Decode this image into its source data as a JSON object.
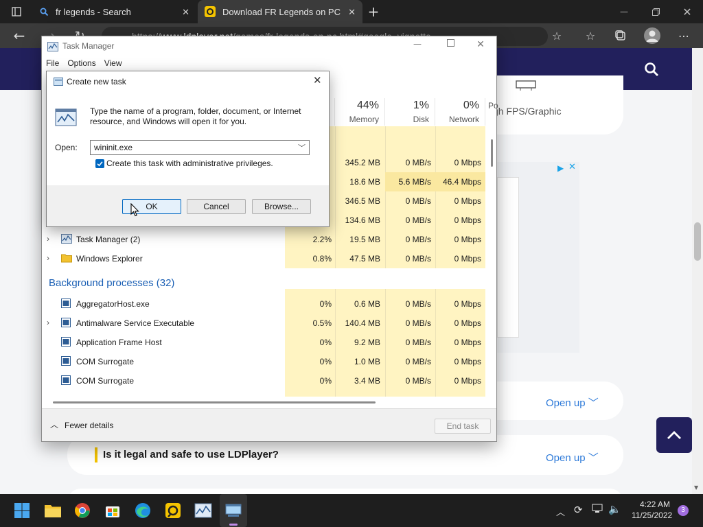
{
  "browser": {
    "tabs": [
      {
        "title": "fr legends - Search",
        "active": false
      },
      {
        "title": "Download FR Legends on PC (Em",
        "active": true
      }
    ],
    "address": {
      "prefix": "https://",
      "domain": "www.ldplayer.net",
      "path": "/games/fr-legends-on-pc.html#google_vignette"
    }
  },
  "webpage": {
    "feature_text": "gh FPS/Graphic",
    "faq": [
      {
        "question": "",
        "open_label": "Open up"
      },
      {
        "question": "Is it legal and safe to use LDPlayer?",
        "open_label": "Open up"
      }
    ],
    "accent": "#22205c",
    "link_color": "#2f7bd9"
  },
  "task_manager": {
    "title": "Task Manager",
    "menu": [
      "File",
      "Options",
      "View"
    ],
    "columns": [
      {
        "pct": "44%",
        "label": "Memory"
      },
      {
        "pct": "1%",
        "label": "Disk"
      },
      {
        "pct": "0%",
        "label": "Network"
      },
      {
        "pct": "",
        "label": "Po"
      }
    ],
    "hidden_rows": [
      {
        "cpu": "",
        "mem": "345.2 MB",
        "disk": "0 MB/s",
        "net": "0 Mbps"
      },
      {
        "cpu": "",
        "mem": "18.6 MB",
        "disk": "5.6 MB/s",
        "net": "46.4 Mbps"
      },
      {
        "cpu": "",
        "mem": "346.5 MB",
        "disk": "0 MB/s",
        "net": "0 Mbps"
      },
      {
        "cpu": "",
        "mem": "134.6 MB",
        "disk": "0 MB/s",
        "net": "0 Mbps"
      }
    ],
    "apps": [
      {
        "name": "Task Manager (2)",
        "cpu": "2.2%",
        "mem": "19.5 MB",
        "disk": "0 MB/s",
        "net": "0 Mbps"
      },
      {
        "name": "Windows Explorer",
        "cpu": "0.8%",
        "mem": "47.5 MB",
        "disk": "0 MB/s",
        "net": "0 Mbps"
      }
    ],
    "background_title": "Background processes (32)",
    "background": [
      {
        "name": "AggregatorHost.exe",
        "cpu": "0%",
        "mem": "0.6 MB",
        "disk": "0 MB/s",
        "net": "0 Mbps",
        "expandable": false
      },
      {
        "name": "Antimalware Service Executable",
        "cpu": "0.5%",
        "mem": "140.4 MB",
        "disk": "0 MB/s",
        "net": "0 Mbps",
        "expandable": true
      },
      {
        "name": "Application Frame Host",
        "cpu": "0%",
        "mem": "9.2 MB",
        "disk": "0 MB/s",
        "net": "0 Mbps",
        "expandable": false
      },
      {
        "name": "COM Surrogate",
        "cpu": "0%",
        "mem": "1.0 MB",
        "disk": "0 MB/s",
        "net": "0 Mbps",
        "expandable": false
      },
      {
        "name": "COM Surrogate",
        "cpu": "0%",
        "mem": "3.4 MB",
        "disk": "0 MB/s",
        "net": "0 Mbps",
        "expandable": false
      }
    ],
    "fewer_details": "Fewer details",
    "end_task": "End task"
  },
  "run_dialog": {
    "title": "Create new task",
    "description": "Type the name of a program, folder, document, or Internet resource, and Windows will open it for you.",
    "open_label": "Open:",
    "open_value": "wininit.exe",
    "admin_label": "Create this task with administrative privileges.",
    "admin_checked": true,
    "ok": "OK",
    "cancel": "Cancel",
    "browse": "Browse..."
  },
  "taskbar": {
    "time": "4:22 AM",
    "date": "11/25/2022",
    "notifications": "3"
  }
}
